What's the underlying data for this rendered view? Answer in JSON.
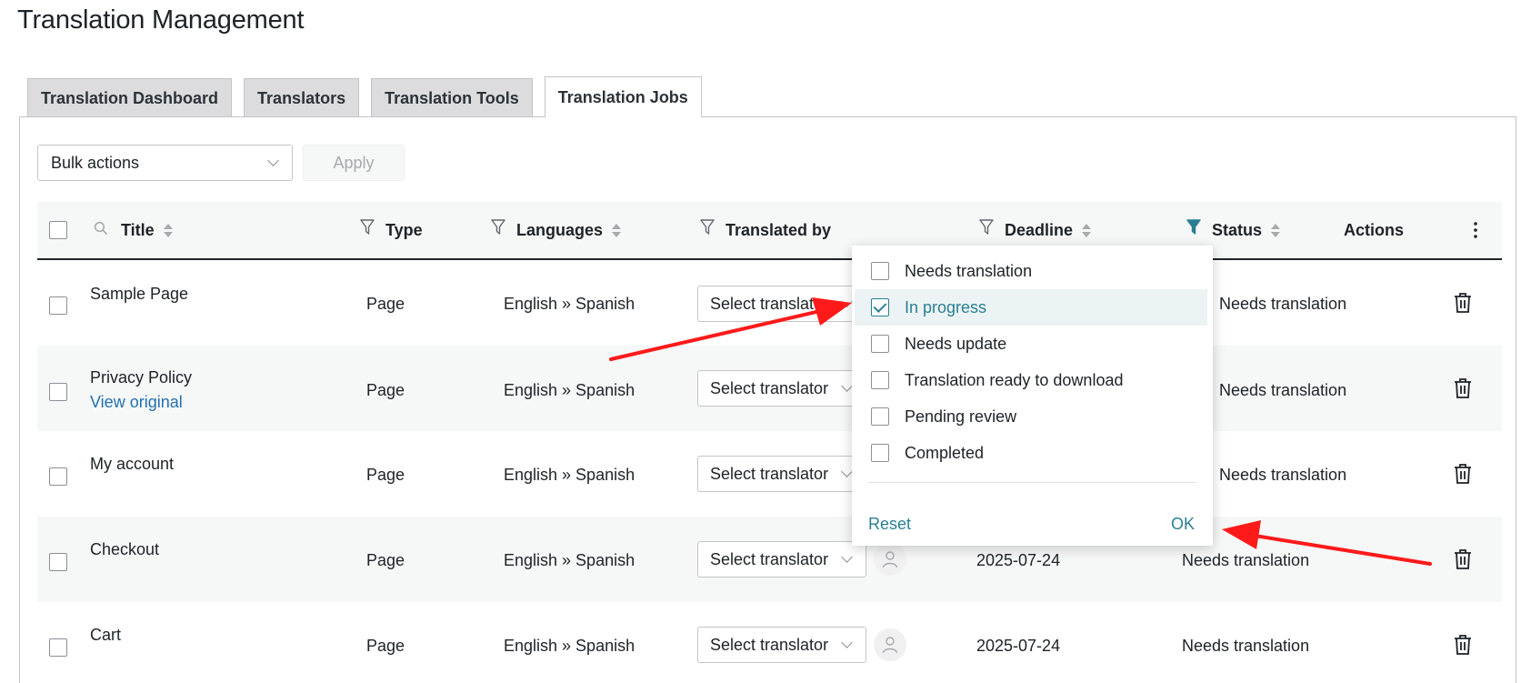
{
  "page_title": "Translation Management",
  "tabs": [
    {
      "label": "Translation Dashboard",
      "active": false
    },
    {
      "label": "Translators",
      "active": false
    },
    {
      "label": "Translation Tools",
      "active": false
    },
    {
      "label": "Translation Jobs",
      "active": true
    }
  ],
  "toolbar": {
    "bulk_actions": "Bulk actions",
    "apply": "Apply"
  },
  "columns": {
    "title": "Title",
    "type": "Type",
    "languages": "Languages",
    "translated_by": "Translated by",
    "deadline": "Deadline",
    "status": "Status",
    "actions": "Actions"
  },
  "rows": [
    {
      "title": "Sample Page",
      "link": "",
      "type": "Page",
      "languages": "English » Spanish",
      "translator": "Select translator",
      "deadline": "",
      "status": "Needs translation"
    },
    {
      "title": "Privacy Policy",
      "link": "View original",
      "type": "Page",
      "languages": "English » Spanish",
      "translator": "Select translator",
      "deadline": "",
      "status": "Needs translation"
    },
    {
      "title": "My account",
      "link": "",
      "type": "Page",
      "languages": "English » Spanish",
      "translator": "Select translator",
      "deadline": "",
      "status": "Needs translation"
    },
    {
      "title": "Checkout",
      "link": "",
      "type": "Page",
      "languages": "English » Spanish",
      "translator": "Select translator",
      "deadline": "2025-07-24",
      "status": "Needs translation"
    },
    {
      "title": "Cart",
      "link": "",
      "type": "Page",
      "languages": "English » Spanish",
      "translator": "Select translator",
      "deadline": "2025-07-24",
      "status": "Needs translation"
    }
  ],
  "status_filter": {
    "options": [
      {
        "label": "Needs translation",
        "checked": false
      },
      {
        "label": "In progress",
        "checked": true
      },
      {
        "label": "Needs update",
        "checked": false
      },
      {
        "label": "Translation ready to download",
        "checked": false
      },
      {
        "label": "Pending review",
        "checked": false
      },
      {
        "label": "Completed",
        "checked": false
      }
    ],
    "reset": "Reset",
    "ok": "OK"
  },
  "colors": {
    "accent": "#2a7f94",
    "link": "#2271b1",
    "annotation_arrow": "#ff1a1a",
    "active_filter_icon": "#2a7f94"
  }
}
